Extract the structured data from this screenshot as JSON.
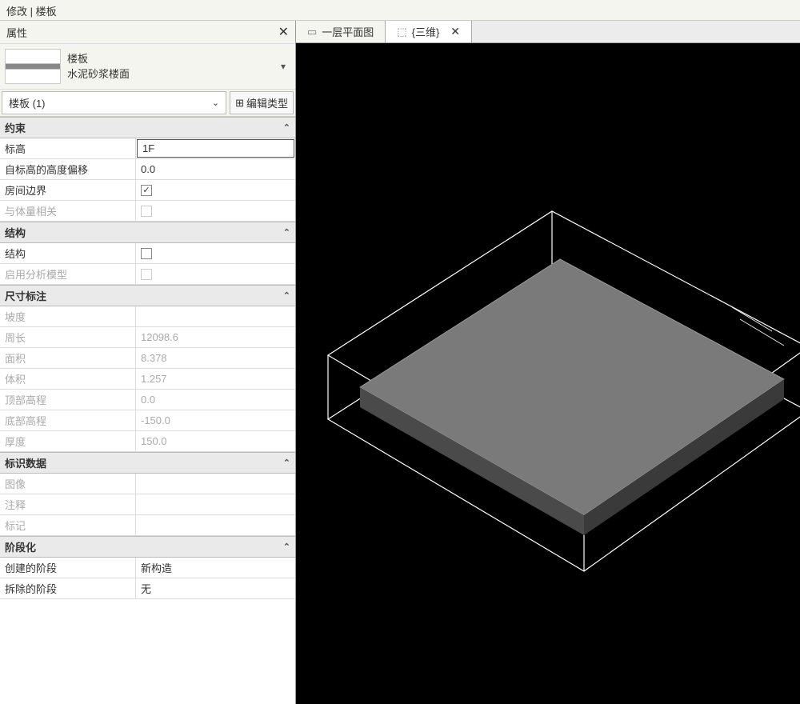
{
  "title_bar": "修改 | 楼板",
  "panel": {
    "title": "属性",
    "type_line1": "楼板",
    "type_line2": "水泥砂浆楼面",
    "instance_label": "楼板 (1)",
    "edit_type": "编辑类型"
  },
  "groups": {
    "constraints": {
      "title": "约束",
      "level_label": "标高",
      "level_value": "1F",
      "offset_label": "自标高的高度偏移",
      "offset_value": "0.0",
      "room_bound_label": "房间边界",
      "room_bound_checked": "✓",
      "mass_rel_label": "与体量相关"
    },
    "structural": {
      "title": "结构",
      "struct_label": "结构",
      "analytical_label": "启用分析模型"
    },
    "dimensions": {
      "title": "尺寸标注",
      "slope_label": "坡度",
      "slope_value": "",
      "perimeter_label": "周长",
      "perimeter_value": "12098.6",
      "area_label": "面积",
      "area_value": "8.378",
      "volume_label": "体积",
      "volume_value": "1.257",
      "top_elev_label": "顶部高程",
      "top_elev_value": "0.0",
      "bottom_elev_label": "底部高程",
      "bottom_elev_value": "-150.0",
      "thickness_label": "厚度",
      "thickness_value": "150.0"
    },
    "identity": {
      "title": "标识数据",
      "image_label": "图像",
      "comment_label": "注释",
      "mark_label": "标记"
    },
    "phasing": {
      "title": "阶段化",
      "created_label": "创建的阶段",
      "created_value": "新构造",
      "demolished_label": "拆除的阶段",
      "demolished_value": "无"
    }
  },
  "tabs": {
    "plan": "一层平面图",
    "threeD": "{三维}"
  }
}
